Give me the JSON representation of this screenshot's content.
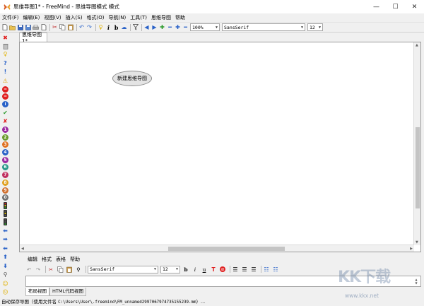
{
  "window": {
    "title": "思维导图1* - FreeMind - 思维导图模式 模式",
    "minimize": "—",
    "maximize": "☐",
    "close": "✕"
  },
  "menu": [
    "文件(F)",
    "编辑(E)",
    "视图(V)",
    "插入(S)",
    "格式(O)",
    "导航(N)",
    "工具(T)",
    "思维导图",
    "帮助"
  ],
  "toolbar": {
    "zoom": "100%",
    "font": "SansSerif",
    "size": "12"
  },
  "map": {
    "tab_label": "思维导图1*",
    "root_node": "新建思维导图"
  },
  "editor": {
    "menu": [
      "编辑",
      "格式",
      "表格",
      "帮助"
    ],
    "font": "SansSerif",
    "size": "12",
    "content": ""
  },
  "bottom_tabs": [
    "布局视图",
    "HTML代码视图"
  ],
  "status": {
    "prefix": "自动保存导图（使用文件名 ",
    "path": "C:\\Users\\User\\.freemind\\FM_unnamed2997067974735155239.mm",
    "suffix": "）..."
  },
  "watermark": {
    "logo": "KK下载",
    "url": "www.kkx.net"
  },
  "colors": {
    "accent_red": "#e02020",
    "accent_blue": "#2a62c8",
    "accent_green": "#2a9a2a",
    "node_fill": "#e4e4e4"
  }
}
